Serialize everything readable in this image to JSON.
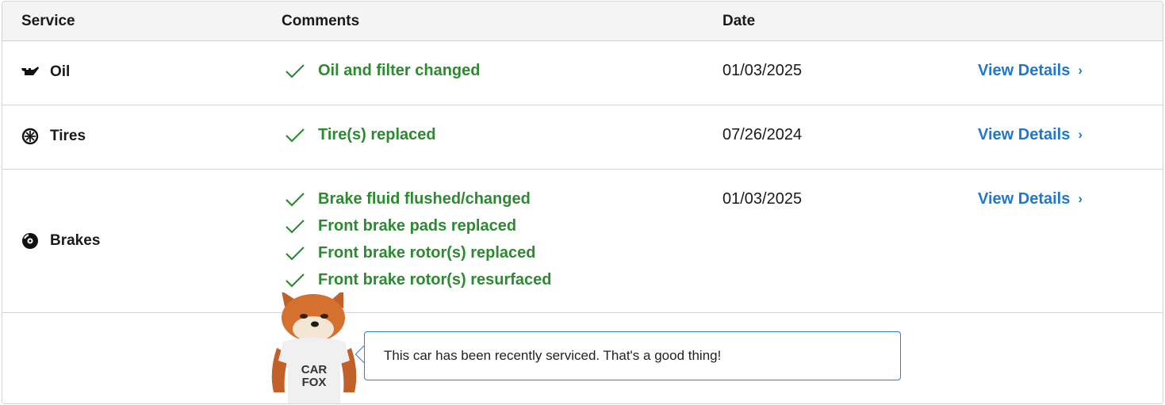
{
  "header": {
    "service": "Service",
    "comments": "Comments",
    "date": "Date"
  },
  "rows": [
    {
      "service": "Oil",
      "icon": "oil-can-icon",
      "comments": [
        "Oil and filter changed"
      ],
      "date": "01/03/2025",
      "details": "View Details"
    },
    {
      "service": "Tires",
      "icon": "tire-icon",
      "comments": [
        "Tire(s) replaced"
      ],
      "date": "07/26/2024",
      "details": "View Details"
    },
    {
      "service": "Brakes",
      "icon": "brake-disc-icon",
      "comments": [
        "Brake fluid flushed/changed",
        "Front brake pads replaced",
        "Front brake rotor(s) replaced",
        "Front brake rotor(s) resurfaced"
      ],
      "date": "01/03/2025",
      "details": "View Details"
    }
  ],
  "mascot": {
    "shirt_text_line1": "CAR",
    "shirt_text_line2": "FOX",
    "message": "This car has been recently serviced. That's a good thing!"
  },
  "colors": {
    "check_green": "#2e8a32",
    "link_blue": "#1f78cf",
    "header_bg": "#f4f4f4",
    "border": "#d4d4d4"
  }
}
